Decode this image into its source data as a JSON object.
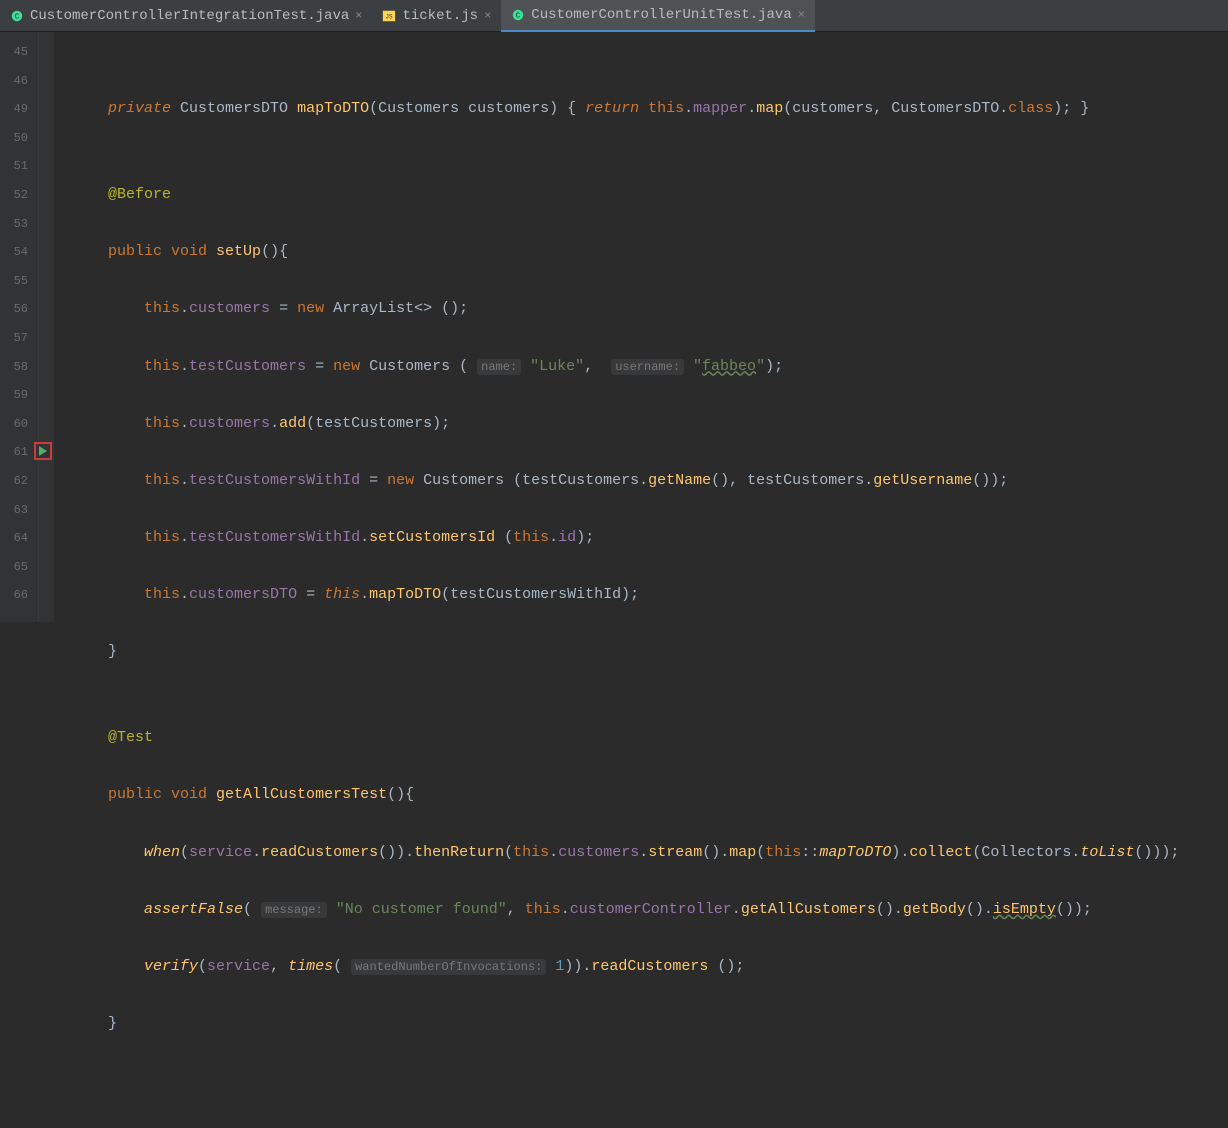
{
  "tabs": [
    {
      "label": "CustomerControllerIntegrationTest.java",
      "icon": "java",
      "active": false
    },
    {
      "label": "ticket.js",
      "icon": "js",
      "active": false
    },
    {
      "label": "CustomerControllerUnitTest.java",
      "icon": "java",
      "active": true
    }
  ],
  "lineNumbers": [
    "45",
    "46",
    "49",
    "50",
    "51",
    "52",
    "53",
    "54",
    "55",
    "56",
    "57",
    "58",
    "59",
    "60",
    "61",
    "62",
    "63",
    "64",
    "65",
    "66"
  ],
  "runMarkerLine": "61",
  "code": {
    "l46": {
      "k1": "private",
      "t1": " CustomersDTO ",
      "m1": "mapToDTO",
      "rest1": "(Customers customers) { ",
      "k2": "return ",
      "k3": "this",
      "dot1": ".",
      "f1": "mapper",
      "dot2": ".",
      "m2": "map",
      "rest2": "(customers, CustomersDTO.",
      "k4": "class",
      "rest3": "); }"
    },
    "l50": {
      "ann": "@Before"
    },
    "l51": {
      "k1": "public ",
      "k2": "void ",
      "m1": "setUp",
      "rest": "(){"
    },
    "l52": {
      "k1": "this",
      "dot": ".",
      "f1": "customers",
      "eq": " = ",
      "k2": "new ",
      "rest": "ArrayList<> ();"
    },
    "l53": {
      "k1": "this",
      "dot": ".",
      "f1": "testCustomers",
      "eq": " = ",
      "k2": "new ",
      "t1": "Customers ( ",
      "h1": "name:",
      "sp1": " ",
      "s1": "\"Luke\"",
      "c1": ",  ",
      "h2": "username:",
      "sp2": " ",
      "s2": "\"",
      "s2b": "fabbeo",
      "s2c": "\"",
      "rest": ");"
    },
    "l54": {
      "k1": "this",
      "dot": ".",
      "f1": "customers",
      "dot2": ".",
      "m1": "add",
      "rest": "(testCustomers);"
    },
    "l55": {
      "k1": "this",
      "dot": ".",
      "f1": "testCustomersWithId",
      "eq": " = ",
      "k2": "new ",
      "t1": "Customers (testCustomers.",
      "m1": "getName",
      "p1": "(), testCustomers.",
      "m2": "getUsername",
      "p2": "());"
    },
    "l56": {
      "k1": "this",
      "dot": ".",
      "f1": "testCustomersWithId",
      "dot2": ".",
      "m1": "setCustomersId",
      "sp": " (",
      "k2": "this",
      "dot3": ".",
      "f2": "id",
      "rest": ");"
    },
    "l57": {
      "k1": "this",
      "dot": ".",
      "f1": "customersDTO",
      "eq": " = ",
      "k2": "this",
      "dot2": ".",
      "m1": "mapToDTO",
      "rest": "(testCustomersWithId);"
    },
    "l58": {
      "b": "}"
    },
    "l60": {
      "ann": "@Test"
    },
    "l61": {
      "k1": "public ",
      "k2": "void ",
      "m1": "getAllCustomersTest",
      "rest": "(){"
    },
    "l62": {
      "m1": "when",
      "p1": "(",
      "f1": "service",
      "dot": ".",
      "m2": "readCustomers",
      "p2": "()).",
      "m3": "thenReturn",
      "p3": "(",
      "k1": "this",
      "dot2": ".",
      "f2": "customers",
      "dot3": ".",
      "m4": "stream",
      "p4": "().",
      "m5": "map",
      "p5": "(",
      "k2": "this",
      "cc": "::",
      "mref": "mapToDTO",
      "p6": ").",
      "m6": "collect",
      "p7": "(Collectors.",
      "sm": "toList",
      "p8": "()));"
    },
    "l63": {
      "m1": "assertFalse",
      "p1": "( ",
      "h1": "message:",
      "sp": " ",
      "s1": "\"No customer found\"",
      "c": ", ",
      "k1": "this",
      "dot": ".",
      "f1": "customerController",
      "dot2": ".",
      "m2": "getAllCustomers",
      "p2": "().",
      "m3": "getBody",
      "p3": "().",
      "m4": "isEmpty",
      "p4": "());"
    },
    "l64": {
      "m1": "verify",
      "p1": "(",
      "f1": "service",
      "c": ", ",
      "m2": "times",
      "p2": "( ",
      "h1": "wantedNumberOfInvocations:",
      "sp": " ",
      "n1": "1",
      "p3": ")).",
      "m3": "readCustomers",
      "p4": " ();"
    },
    "l65": {
      "b": "}"
    }
  }
}
